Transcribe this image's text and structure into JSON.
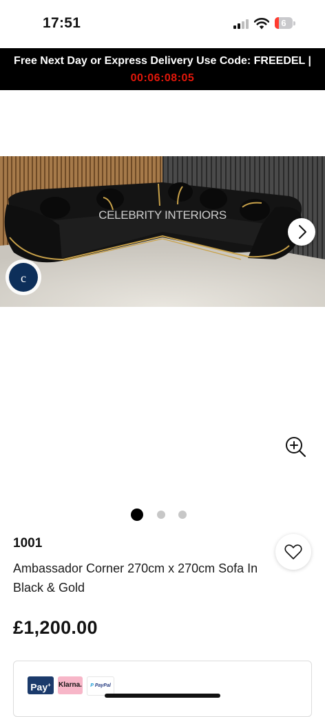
{
  "status_bar": {
    "time": "17:51",
    "battery_level": "6",
    "icons": [
      "signal-icon",
      "wifi-icon",
      "battery-icon"
    ]
  },
  "promo_banner": {
    "text": "Free Next Day or Express Delivery Use Code: FREEDEL |",
    "countdown": "00:06:08:05",
    "countdown_color": "#e3170a"
  },
  "gallery": {
    "watermark": "CELEBRITY INTERIORS",
    "slide_count": 3,
    "active_slide": 1,
    "icons": [
      "chevron-right-icon",
      "zoom-in-icon"
    ]
  },
  "product": {
    "sku": "1001",
    "title": "Ambassador Corner 270cm x 270cm Sofa In Black & Gold",
    "price": "£1,200.00"
  },
  "payment": {
    "pay_plus_label": "Pay",
    "klarna_label": "Klarna.",
    "paypal_label": "PayPal"
  },
  "colors": {
    "banner_bg": "#000000",
    "accent_red": "#e3170a",
    "sofa_gold": "#c9a24a"
  }
}
